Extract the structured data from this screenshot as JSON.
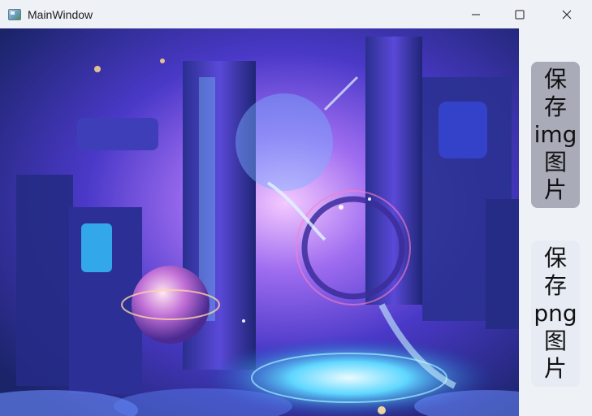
{
  "window": {
    "title": "MainWindow"
  },
  "buttons": {
    "save_img": "保\n存\nimg\n图\n片",
    "save_png": "保\n存\npng\n图\n片"
  },
  "colors": {
    "titlebar": "#eef1f6",
    "button_img_bg": "#a9acb8",
    "button_png_bg": "#e7ecf4"
  }
}
